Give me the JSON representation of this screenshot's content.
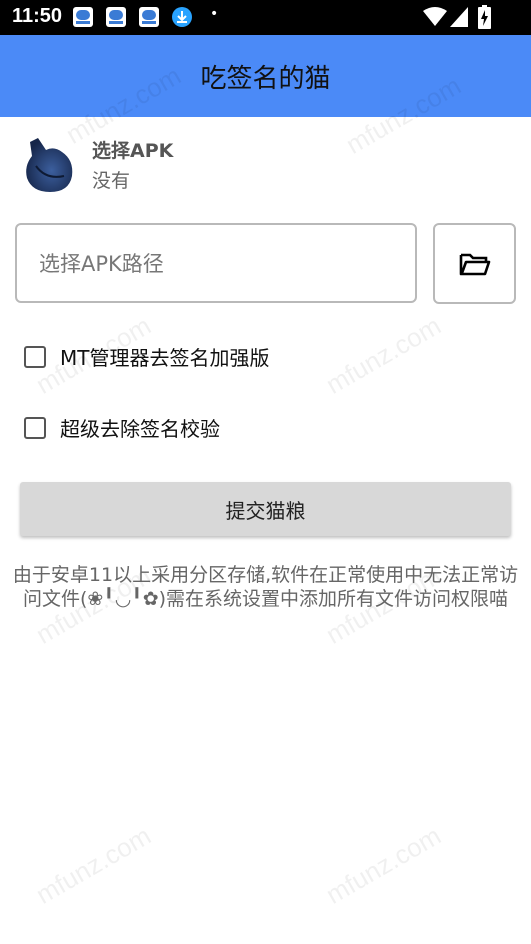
{
  "status_bar": {
    "time": "11:50",
    "notification_icons": [
      "app-notification-icon",
      "app-notification-icon",
      "app-notification-icon",
      "download-icon"
    ],
    "dot": "•",
    "right_icons": [
      "wifi-icon",
      "signal-icon",
      "battery-charging-icon"
    ]
  },
  "app_bar": {
    "title": "吃签名的猫"
  },
  "apk_info": {
    "name": "选择APK",
    "status": "没有",
    "avatar_icon": "cat-icon"
  },
  "path_input": {
    "placeholder": "选择APK路径",
    "value": ""
  },
  "folder_button": {
    "icon": "folder-open-icon"
  },
  "options": [
    {
      "label": "MT管理器去签名加强版",
      "checked": false
    },
    {
      "label": "超级去除签名校验",
      "checked": false
    }
  ],
  "submit_button": {
    "label": "提交猫粮"
  },
  "notice": "由于安卓11以上采用分区存储,软件在正常使用中无法正常访问文件(❀╹◡╹✿)需在系统设置中添加所有文件访问权限喵",
  "watermark_text": "mfunz.com",
  "colors": {
    "app_bar": "#4b8af7",
    "status_bar": "#000000",
    "submit_bg": "#d8d8d8",
    "border": "#b9b9b9"
  }
}
